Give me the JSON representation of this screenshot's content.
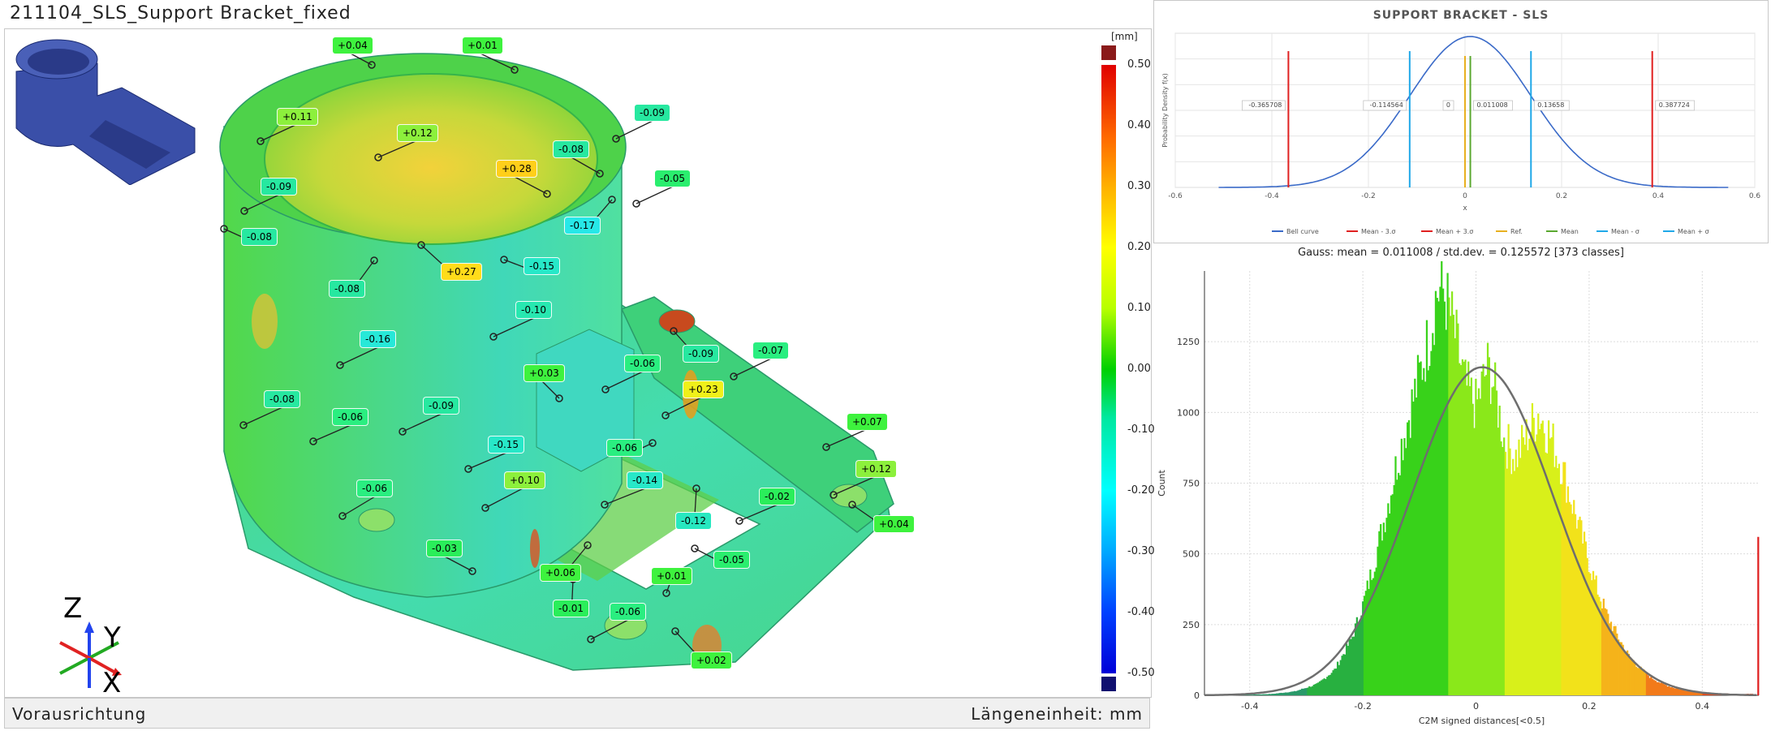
{
  "document": {
    "title": "211104_SLS_Support Bracket_fixed"
  },
  "status_bar": {
    "left": "Vorausrichtung",
    "right": "Längeneinheit: mm"
  },
  "color_scale": {
    "unit": "[mm]",
    "ticks": [
      "0.50",
      "0.40",
      "0.30",
      "0.20",
      "0.10",
      "0.00",
      "-0.10",
      "-0.20",
      "-0.30",
      "-0.40",
      "-0.50"
    ]
  },
  "axis_triad": {
    "z": "Z",
    "y": "Y",
    "x": "X"
  },
  "callouts": [
    {
      "label": "+0.04",
      "color": "#3ef23e"
    },
    {
      "label": "+0.01",
      "color": "#3ef23e"
    },
    {
      "label": "+0.11",
      "color": "#8cf03c"
    },
    {
      "label": "-0.09",
      "color": "#27e8a0"
    },
    {
      "label": "+0.12",
      "color": "#8cf03c"
    },
    {
      "label": "-0.08",
      "color": "#27e8a0"
    },
    {
      "label": "+0.28",
      "color": "#ffcf1a"
    },
    {
      "label": "-0.09",
      "color": "#27e8a0"
    },
    {
      "label": "-0.05",
      "color": "#2aee6e"
    },
    {
      "label": "-0.08",
      "color": "#27e8a0"
    },
    {
      "label": "-0.17",
      "color": "#27e8e8"
    },
    {
      "label": "+0.27",
      "color": "#ffdc1a"
    },
    {
      "label": "-0.15",
      "color": "#27e8c8"
    },
    {
      "label": "-0.08",
      "color": "#27e8a0"
    },
    {
      "label": "-0.10",
      "color": "#27e8b0"
    },
    {
      "label": "-0.16",
      "color": "#27e8d8"
    },
    {
      "label": "+0.03",
      "color": "#3ef23e"
    },
    {
      "label": "-0.06",
      "color": "#2aee80"
    },
    {
      "label": "-0.09",
      "color": "#27e8a0"
    },
    {
      "label": "-0.07",
      "color": "#2aee80"
    },
    {
      "label": "+0.23",
      "color": "#f0f01a"
    },
    {
      "label": "-0.08",
      "color": "#27e8a0"
    },
    {
      "label": "-0.06",
      "color": "#2aee80"
    },
    {
      "label": "-0.09",
      "color": "#27e8a0"
    },
    {
      "label": "-0.15",
      "color": "#27e8c8"
    },
    {
      "label": "-0.06",
      "color": "#2aee80"
    },
    {
      "label": "+0.07",
      "color": "#3ef23e"
    },
    {
      "label": "+0.12",
      "color": "#8cf03c"
    },
    {
      "label": "+0.10",
      "color": "#8cf03c"
    },
    {
      "label": "-0.14",
      "color": "#27e8c8"
    },
    {
      "label": "-0.06",
      "color": "#2aee80"
    },
    {
      "label": "-0.02",
      "color": "#2aee5a"
    },
    {
      "label": "-0.12",
      "color": "#27e8c0"
    },
    {
      "label": "+0.04",
      "color": "#3ef23e"
    },
    {
      "label": "-0.03",
      "color": "#2aee5a"
    },
    {
      "label": "+0.06",
      "color": "#3ef23e"
    },
    {
      "label": "-0.05",
      "color": "#2aee6e"
    },
    {
      "label": "+0.01",
      "color": "#3ef23e"
    },
    {
      "label": "-0.01",
      "color": "#2aee5a"
    },
    {
      "label": "-0.06",
      "color": "#2aee80"
    },
    {
      "label": "+0.02",
      "color": "#3ef23e"
    }
  ],
  "chart_data": [
    {
      "type": "line",
      "title": "SUPPORT BRACKET - SLS",
      "xlabel": "x",
      "ylabel": "Probability Density f(x)",
      "xlim": [
        -0.6,
        0.6
      ],
      "x_ticks": [
        "-0.6",
        "-0.4",
        "-0.2",
        "0",
        "0.2",
        "0.4",
        "0.6"
      ],
      "curve": {
        "mean": 0.011008,
        "std": 0.125572
      },
      "vertical_lines": [
        {
          "name": "Mean - 3.σ",
          "x": -0.365708,
          "label": "-0.365708",
          "color": "#e02020"
        },
        {
          "name": "Mean - σ",
          "x": -0.114564,
          "label": "-0.114564",
          "color": "#20a8e8"
        },
        {
          "name": "Ref.",
          "x": 0,
          "label": "0",
          "color": "#e8b020"
        },
        {
          "name": "Mean",
          "x": 0.011008,
          "label": "0.011008",
          "color": "#5aa830"
        },
        {
          "name": "Mean + σ",
          "x": 0.13658,
          "label": "0.13658",
          "color": "#20a8e8"
        },
        {
          "name": "Mean + 3.σ",
          "x": 0.387724,
          "label": "0.387724",
          "color": "#e02020"
        }
      ],
      "legend": [
        {
          "name": "Bell curve",
          "color": "#3a6ac8"
        },
        {
          "name": "Mean - 3.σ",
          "color": "#e02020"
        },
        {
          "name": "Mean + 3.σ",
          "color": "#e02020"
        },
        {
          "name": "Ref.",
          "color": "#e8b020"
        },
        {
          "name": "Mean",
          "color": "#5aa830"
        },
        {
          "name": "Mean - σ",
          "color": "#20a8e8"
        },
        {
          "name": "Mean + σ",
          "color": "#20a8e8"
        }
      ],
      "legend_position": "bottom",
      "caption": "Gauss: mean = 0.011008 / std.dev. = 0.125572 [373 classes]"
    },
    {
      "type": "bar",
      "xlabel": "C2M signed distances[<0.5]",
      "ylabel": "Count",
      "xlim": [
        -0.48,
        0.5
      ],
      "ylim": [
        0,
        1500
      ],
      "x_ticks": [
        "-0.4",
        "-0.2",
        "0",
        "0.2",
        "0.4"
      ],
      "y_ticks": [
        "0",
        "250",
        "500",
        "750",
        "1000",
        "1250"
      ],
      "grid": true,
      "envelope": [
        [
          -0.48,
          0
        ],
        [
          -0.4,
          2
        ],
        [
          -0.36,
          5
        ],
        [
          -0.32,
          14
        ],
        [
          -0.28,
          40
        ],
        [
          -0.25,
          90
        ],
        [
          -0.22,
          200
        ],
        [
          -0.2,
          320
        ],
        [
          -0.18,
          470
        ],
        [
          -0.16,
          640
        ],
        [
          -0.14,
          820
        ],
        [
          -0.12,
          980
        ],
        [
          -0.1,
          1130
        ],
        [
          -0.08,
          1290
        ],
        [
          -0.07,
          1420
        ],
        [
          -0.06,
          1440
        ],
        [
          -0.05,
          1380
        ],
        [
          -0.04,
          1300
        ],
        [
          -0.03,
          1200
        ],
        [
          -0.02,
          1100
        ],
        [
          0.0,
          1020
        ],
        [
          0.02,
          1160
        ],
        [
          0.03,
          1110
        ],
        [
          0.05,
          900
        ],
        [
          0.07,
          840
        ],
        [
          0.09,
          920
        ],
        [
          0.11,
          1000
        ],
        [
          0.13,
          920
        ],
        [
          0.15,
          820
        ],
        [
          0.17,
          680
        ],
        [
          0.19,
          540
        ],
        [
          0.21,
          400
        ],
        [
          0.23,
          290
        ],
        [
          0.25,
          210
        ],
        [
          0.27,
          140
        ],
        [
          0.29,
          95
        ],
        [
          0.31,
          62
        ],
        [
          0.33,
          40
        ],
        [
          0.35,
          26
        ],
        [
          0.37,
          17
        ],
        [
          0.4,
          10
        ],
        [
          0.43,
          7
        ],
        [
          0.47,
          4
        ],
        [
          0.49,
          6
        ]
      ],
      "last_bin_spike": 560,
      "fit_curve": {
        "mean": 0.011008,
        "std": 0.125572,
        "peak": 1160
      }
    }
  ]
}
